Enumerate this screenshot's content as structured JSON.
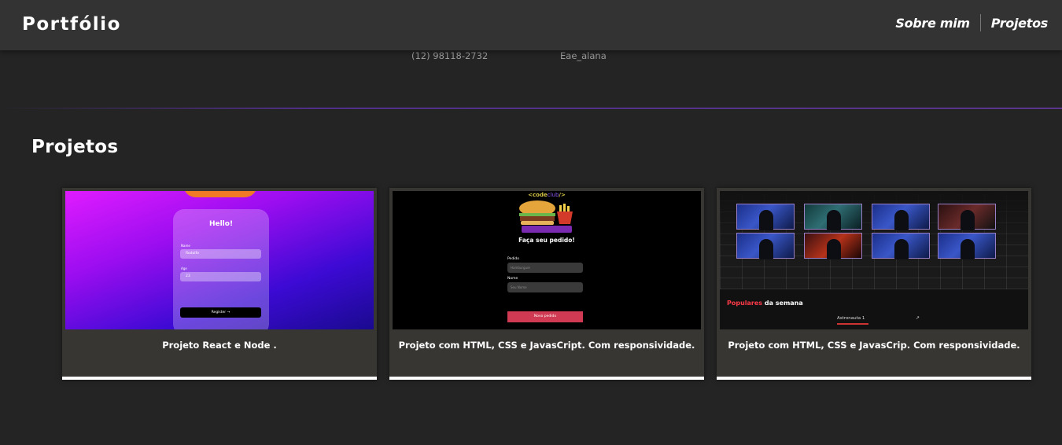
{
  "header": {
    "logo": "Portfólio",
    "nav": [
      {
        "label": "Sobre mim"
      },
      {
        "label": "Projetos"
      }
    ]
  },
  "contact": {
    "phone": "(12) 98118-2732",
    "handle": "Eae_alana"
  },
  "projects_section": {
    "title": "Projetos",
    "cards": [
      {
        "caption": "Projeto React e Node .",
        "thumb": {
          "title": "Hello!",
          "fields": [
            {
              "label": "Name",
              "value": "Rodolfo"
            },
            {
              "label": "Age",
              "value": "23"
            }
          ],
          "button": "Register"
        }
      },
      {
        "caption": "Projeto com HTML, CSS e JavasCript. Com responsividade.",
        "thumb": {
          "brand_prefix": "<code",
          "brand_mid": "club",
          "brand_suffix": "/>",
          "headline": "Faça seu pedido!",
          "fields": [
            {
              "label": "Pedido",
              "value": "Hamburguer"
            },
            {
              "label": "Nome",
              "value": "Seu Nome"
            }
          ],
          "button": "Novo pedido"
        }
      },
      {
        "caption": "Projeto com HTML, CSS e JavasCrip. Com responsividade.",
        "thumb": {
          "popular_highlight": "Populares",
          "popular_rest": " da semana",
          "item": "Astronauta 1",
          "arrow": "↗"
        }
      }
    ]
  },
  "colors": {
    "background": "#242424",
    "header": "#333333",
    "card": "#383633",
    "accent_line": "#7c3aed",
    "order_button": "#d03a52"
  }
}
